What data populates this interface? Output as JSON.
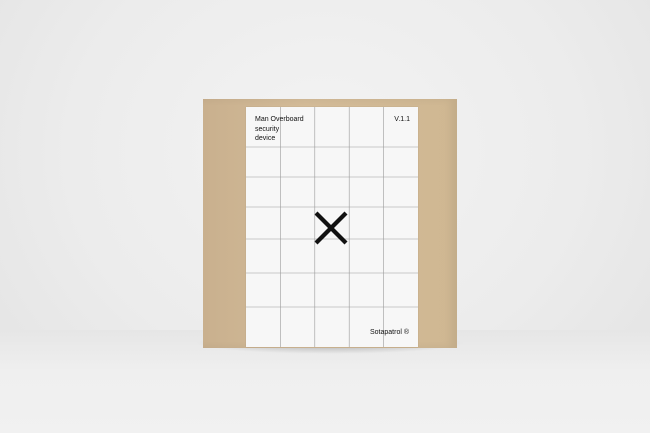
{
  "product": {
    "title": "Man Overboard\nsecurity\ndevice",
    "version": "V.1.1",
    "brand": "Sotapatrol ®",
    "logo_icon": "x-mark-icon"
  },
  "colors": {
    "kraft_sleeve": "#cfb792",
    "label_paper": "#f7f7f7",
    "grid_line": "#9a9a9a",
    "ink": "#111111",
    "background": "#ececec"
  }
}
